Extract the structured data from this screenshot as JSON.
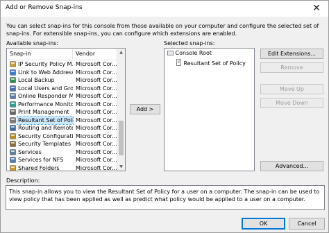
{
  "window": {
    "title": "Add or Remove Snap-ins",
    "close_glyph": "✕"
  },
  "intro_text": "You can select snap-ins for this console from those available on your computer and configure the selected set of snap-ins. For extensible snap-ins, you can configure which extensions are enabled.",
  "available": {
    "label": "Available snap-ins:",
    "columns": {
      "name": "Snap-in",
      "vendor": "Vendor"
    },
    "rows": [
      {
        "name": "IP Security Policy M...",
        "vendor": "Microsoft Cor...",
        "icon": "ip-security-icon"
      },
      {
        "name": "Link to Web Address",
        "vendor": "Microsoft Cor...",
        "icon": "web-link-icon"
      },
      {
        "name": "Local Backup",
        "vendor": "Microsoft Cor...",
        "icon": "backup-icon"
      },
      {
        "name": "Local Users and Gro...",
        "vendor": "Microsoft Cor...",
        "icon": "users-icon"
      },
      {
        "name": "Online Responder M...",
        "vendor": "Microsoft Cor...",
        "icon": "responder-icon"
      },
      {
        "name": "Performance Monitor",
        "vendor": "Microsoft Cor...",
        "icon": "perf-monitor-icon"
      },
      {
        "name": "Print Management",
        "vendor": "Microsoft Cor...",
        "icon": "printer-icon"
      },
      {
        "name": "Resultant Set of Policy",
        "vendor": "Microsoft Cor...",
        "icon": "policy-icon",
        "selected": true
      },
      {
        "name": "Routing and Remote...",
        "vendor": "Microsoft Cor...",
        "icon": "routing-icon"
      },
      {
        "name": "Security Configurati...",
        "vendor": "Microsoft Cor...",
        "icon": "security-config-icon"
      },
      {
        "name": "Security Templates",
        "vendor": "Microsoft Cor...",
        "icon": "security-templates-icon"
      },
      {
        "name": "Services",
        "vendor": "Microsoft Cor...",
        "icon": "services-icon"
      },
      {
        "name": "Services for NFS",
        "vendor": "Microsoft Cor...",
        "icon": "nfs-icon"
      },
      {
        "name": "Shared Folders",
        "vendor": "Microsoft Cor...",
        "icon": "shared-folder-icon"
      }
    ]
  },
  "add_button": "Add >",
  "selected": {
    "label": "Selected snap-ins:",
    "root": "Console Root",
    "child": "Resultant Set of Policy"
  },
  "side_buttons": {
    "edit_extensions": "Edit Extensions...",
    "remove": "Remove",
    "move_up": "Move Up",
    "move_down": "Move Down",
    "advanced": "Advanced..."
  },
  "description": {
    "label": "Description:",
    "text": "This snap-in allows you to view the Resultant Set of Policy for a user on a computer.  The snap-in can be used to view policy that has been applied as well as predict what policy would be applied to a user on a computer."
  },
  "footer": {
    "ok": "OK",
    "cancel": "Cancel"
  },
  "colors": {
    "selection": "#cce8ff",
    "focus_border": "#0078d7"
  }
}
